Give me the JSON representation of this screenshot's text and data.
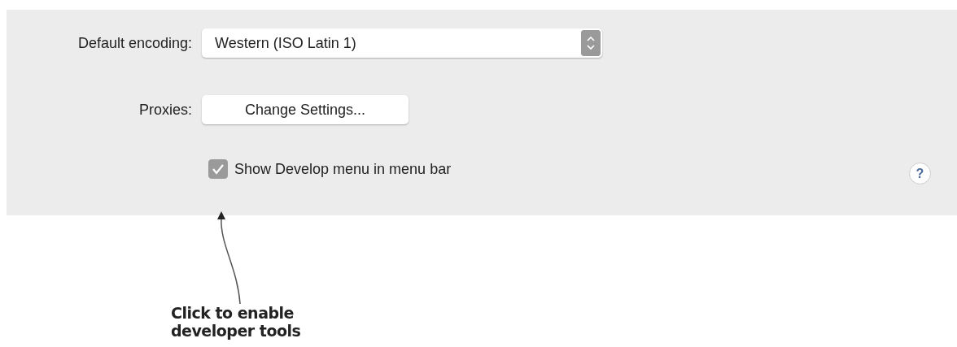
{
  "encoding": {
    "label": "Default encoding:",
    "value": "Western (ISO Latin 1)"
  },
  "proxies": {
    "label": "Proxies:",
    "button": "Change Settings..."
  },
  "develop_menu": {
    "label": "Show Develop menu in menu bar",
    "checked": true
  },
  "help": {
    "label": "?"
  },
  "annotation": {
    "text": "Click to enable developer tools"
  }
}
